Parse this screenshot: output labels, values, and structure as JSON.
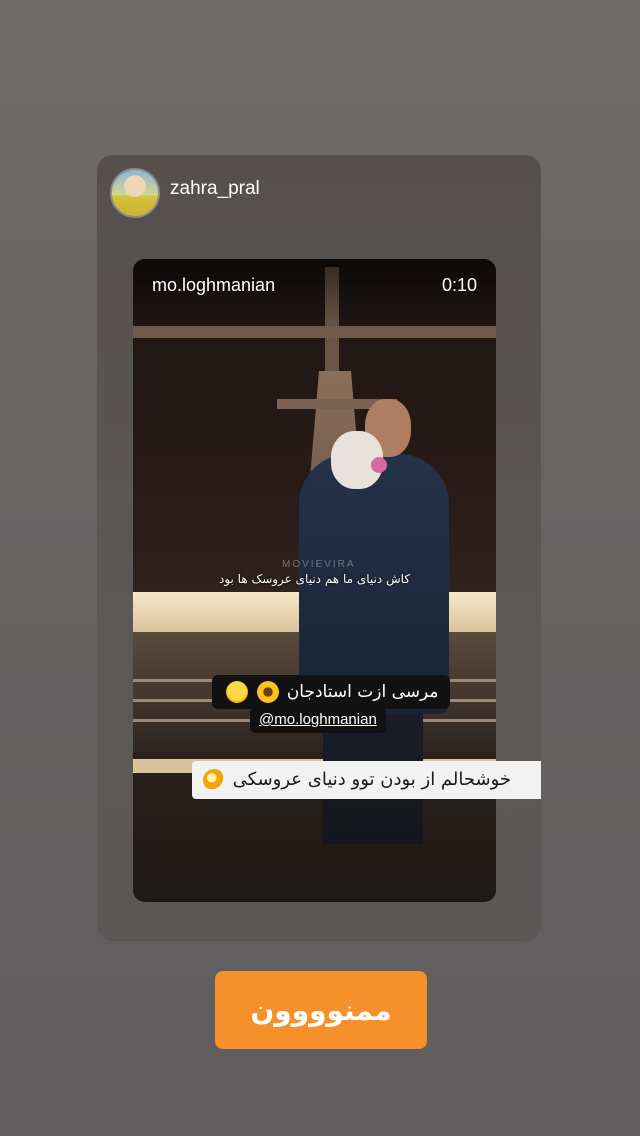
{
  "header": {
    "username": "zahra_pral"
  },
  "video": {
    "username": "mo.loghmanian",
    "time": "0:10",
    "watermark": "MOVIEVIRA",
    "subtitle": "کاش دنیای ما هم دنیای عروسک ها بود"
  },
  "stickers": {
    "thanks": "مرسی ازت استادجان",
    "mention": "@mo.loghmanian",
    "caption": "خوشحالم از بودن توو دنیای عروسکی"
  },
  "reply_button": {
    "label": "ممنوووون"
  },
  "colors": {
    "accent": "#f6902a",
    "background": "#666463",
    "card": "#57524f"
  },
  "icons": [
    "hugging-face-emoji",
    "sunflower-emoji",
    "dizzy-emoji"
  ]
}
